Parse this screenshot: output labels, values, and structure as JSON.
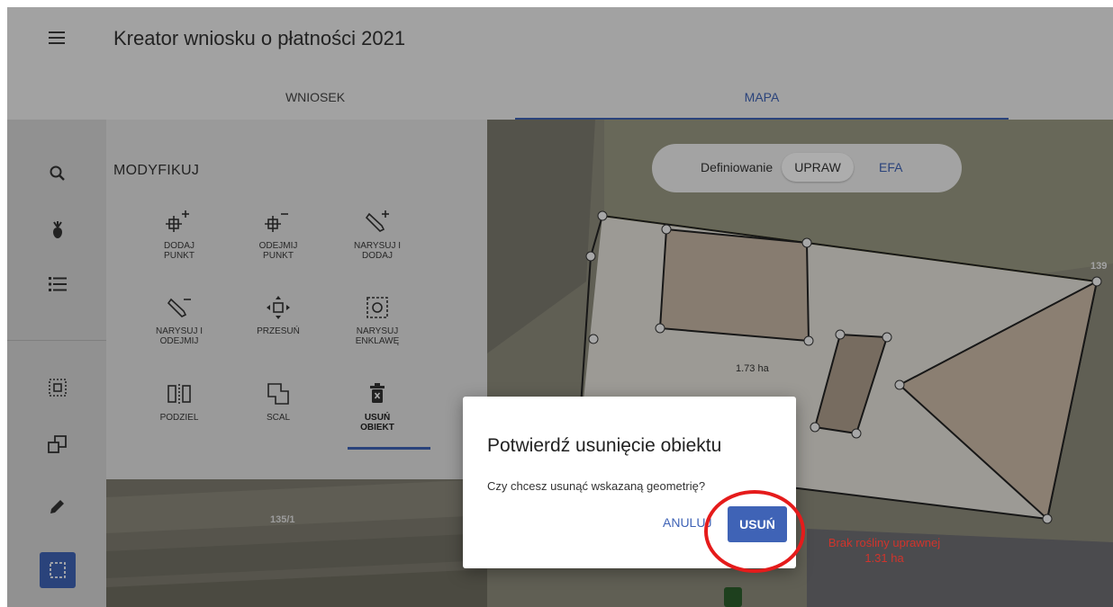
{
  "header": {
    "title": "Kreator wniosku o płatności 2021"
  },
  "tabs": [
    {
      "label": "WNIOSEK"
    },
    {
      "label": "MAPA"
    }
  ],
  "tools_panel": {
    "title": "MODYFIKUJ",
    "tools": [
      {
        "label": "DODAJ\nPUNKT",
        "icon": "add-point-icon"
      },
      {
        "label": "ODEJMIJ\nPUNKT",
        "icon": "remove-point-icon"
      },
      {
        "label": "NARYSUJ I\nDODAJ",
        "icon": "draw-add-icon"
      },
      {
        "label": "NARYSUJ I\nODEJMIJ",
        "icon": "draw-subtract-icon"
      },
      {
        "label": "PRZESUŃ",
        "icon": "move-icon"
      },
      {
        "label": "NARYSUJ\nENKLAWĘ",
        "icon": "enclave-icon"
      },
      {
        "label": "PODZIEL",
        "icon": "split-icon"
      },
      {
        "label": "SCAL",
        "icon": "merge-icon"
      },
      {
        "label": "USUŃ\nOBIEKT",
        "icon": "delete-icon"
      }
    ]
  },
  "map": {
    "toggle_label": "Definiowanie",
    "toggle_options": [
      "UPRAW",
      "EFA"
    ],
    "labels": {
      "area_1": "1.73  ha",
      "parcel_left": "135/1",
      "parcel_right": "139",
      "missing_crop": "Brak rośliny uprawnej",
      "missing_crop_area": "1.31 ha"
    }
  },
  "dialog": {
    "title": "Potwierdź usunięcie obiektu",
    "message": "Czy chcesz usunąć wskazaną geometrię?",
    "cancel_label": "ANULUJ",
    "confirm_label": "USUŃ"
  },
  "colors": {
    "accent": "#3f63b6",
    "highlight": "#e51b1b",
    "missing_crop": "#d0342c"
  }
}
